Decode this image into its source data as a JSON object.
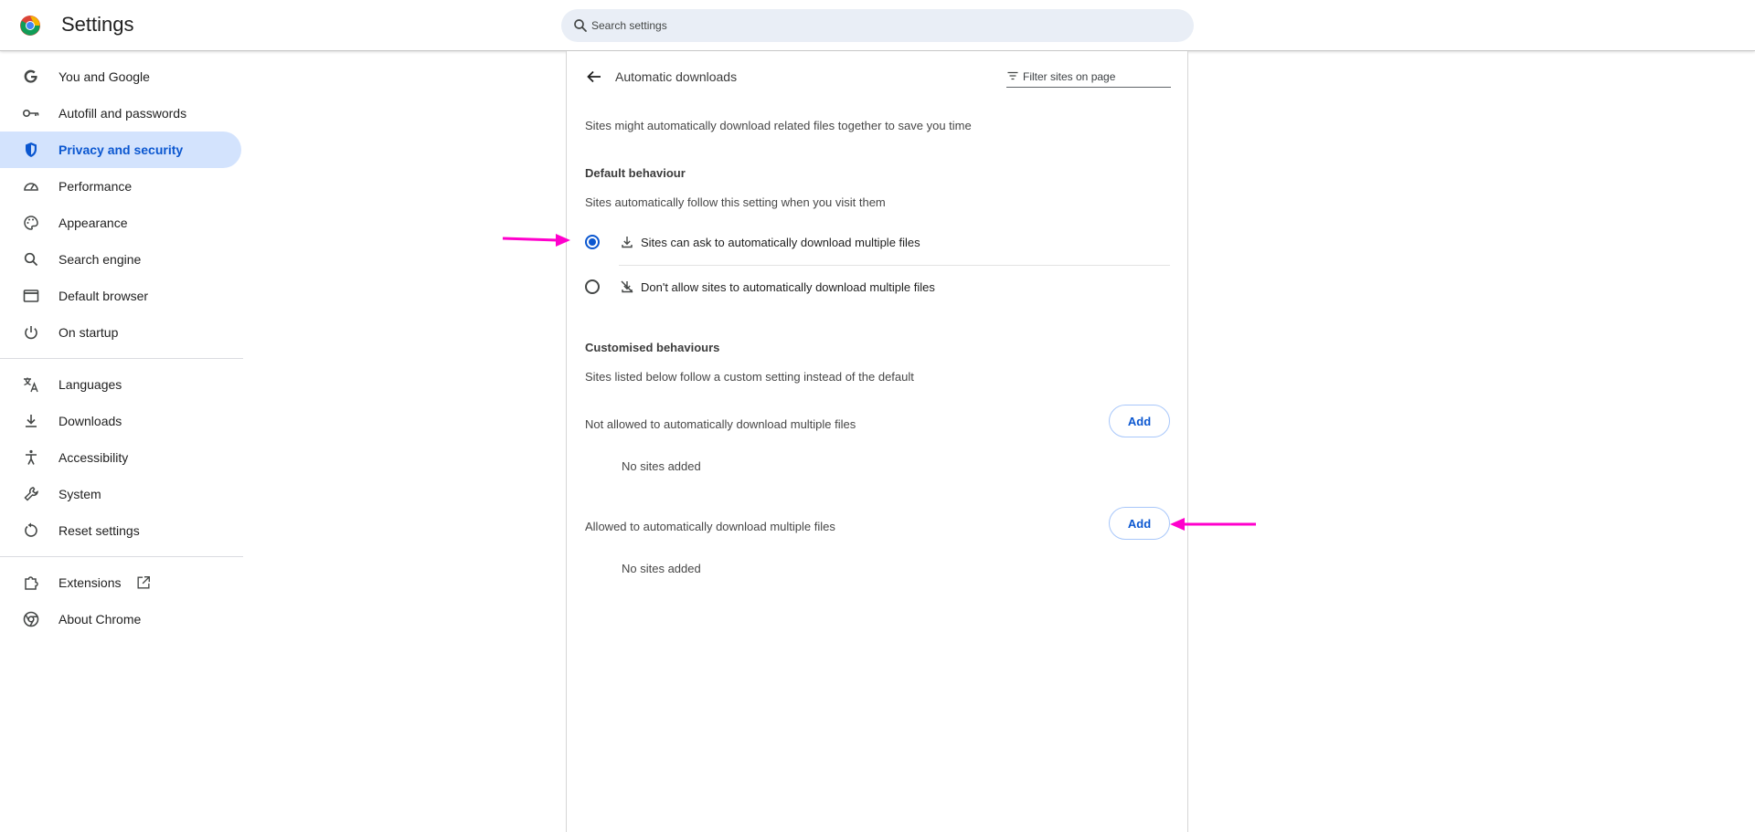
{
  "app": {
    "title": "Settings"
  },
  "search": {
    "placeholder": "Search settings"
  },
  "sidebar": {
    "items": [
      {
        "label": "You and Google",
        "icon": "google-g-icon"
      },
      {
        "label": "Autofill and passwords",
        "icon": "key-icon"
      },
      {
        "label": "Privacy and security",
        "icon": "shield-icon",
        "active": true
      },
      {
        "label": "Performance",
        "icon": "speedometer-icon"
      },
      {
        "label": "Appearance",
        "icon": "palette-icon"
      },
      {
        "label": "Search engine",
        "icon": "search-icon"
      },
      {
        "label": "Default browser",
        "icon": "browser-window-icon"
      },
      {
        "label": "On startup",
        "icon": "power-icon"
      },
      {
        "label": "Languages",
        "icon": "translate-icon"
      },
      {
        "label": "Downloads",
        "icon": "download-icon"
      },
      {
        "label": "Accessibility",
        "icon": "accessibility-icon"
      },
      {
        "label": "System",
        "icon": "wrench-icon"
      },
      {
        "label": "Reset settings",
        "icon": "reset-icon"
      },
      {
        "label": "Extensions",
        "icon": "puzzle-icon"
      },
      {
        "label": "About Chrome",
        "icon": "chrome-icon"
      }
    ]
  },
  "page": {
    "title": "Automatic downloads",
    "filter_placeholder": "Filter sites on page",
    "description": "Sites might automatically download related files together to save you time",
    "default_behaviour": {
      "heading": "Default behaviour",
      "subtext": "Sites automatically follow this setting when you visit them",
      "options": [
        {
          "label": "Sites can ask to automatically download multiple files",
          "icon": "download-icon",
          "checked": true
        },
        {
          "label": "Don't allow sites to automatically download multiple files",
          "icon": "download-off-icon",
          "checked": false
        }
      ]
    },
    "customised_behaviours": {
      "heading": "Customised behaviours",
      "subtext": "Sites listed below follow a custom setting instead of the default",
      "not_allowed": {
        "label": "Not allowed to automatically download multiple files",
        "add_label": "Add",
        "empty_text": "No sites added"
      },
      "allowed": {
        "label": "Allowed to automatically download multiple files",
        "add_label": "Add",
        "empty_text": "No sites added"
      }
    }
  },
  "colors": {
    "accent": "#0b57d0",
    "active_nav_bg": "#d3e3fd",
    "annotation_arrow": "#ff00cc"
  }
}
